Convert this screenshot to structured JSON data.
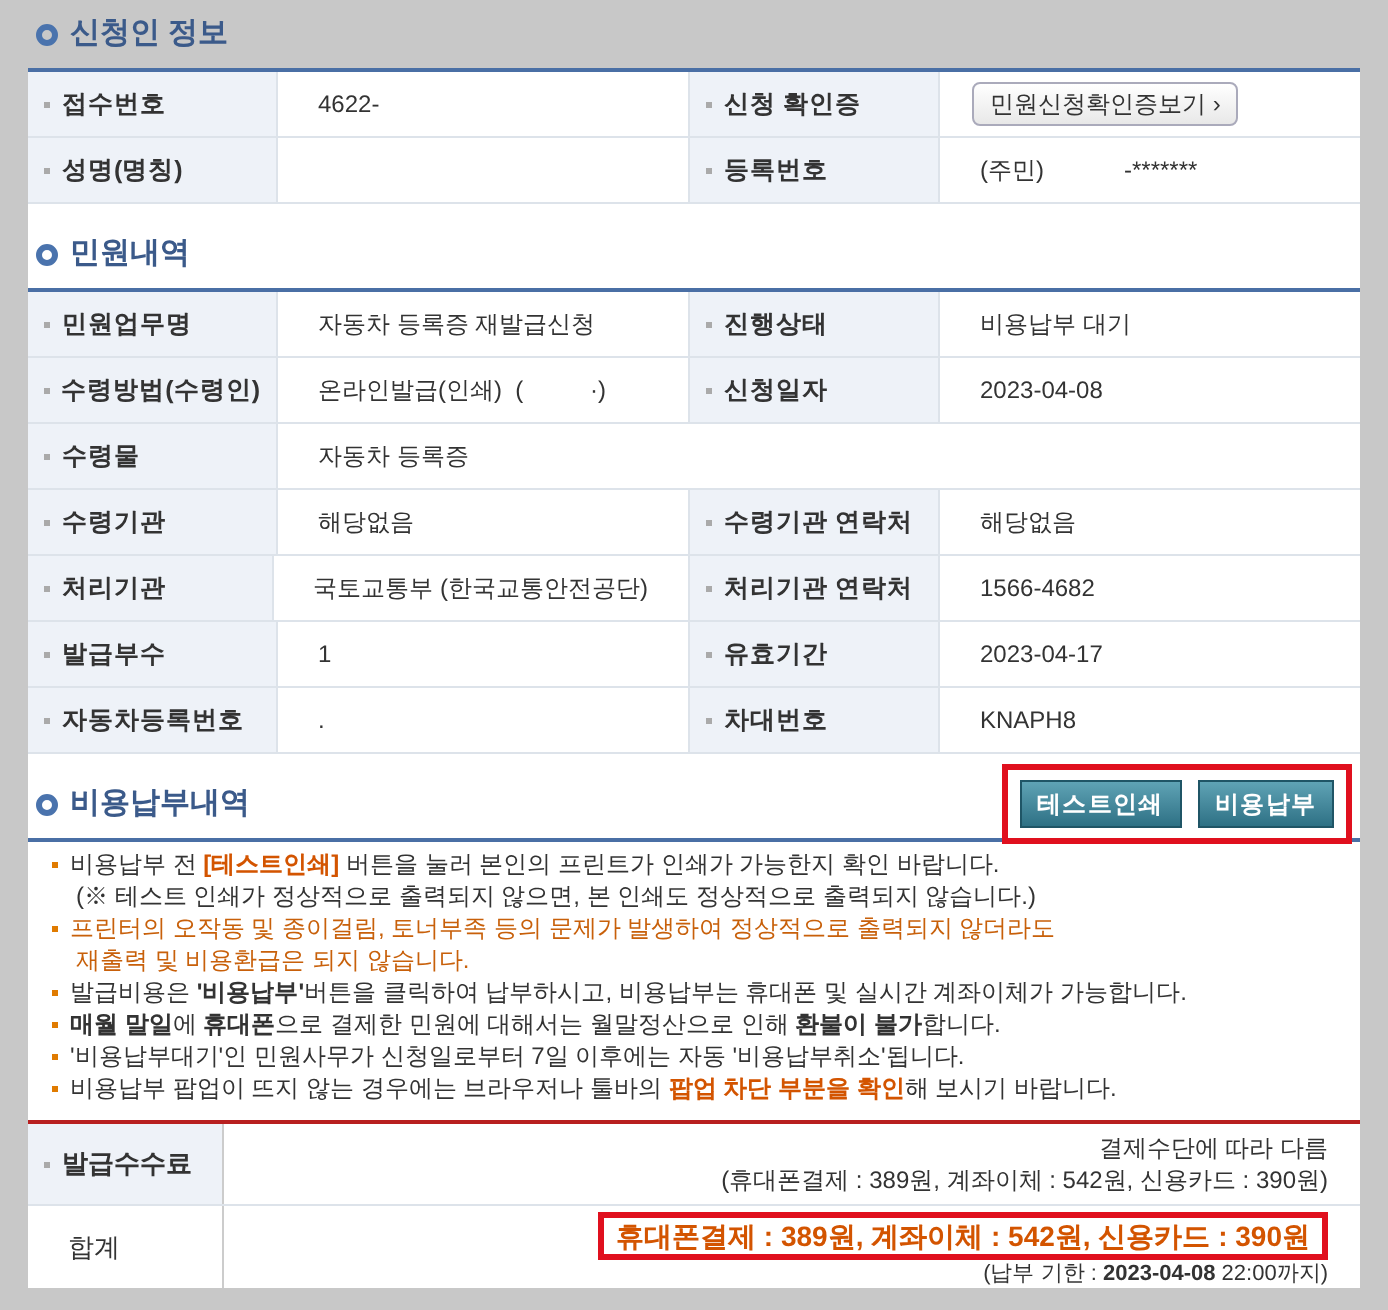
{
  "applicant": {
    "title": "신청인 정보",
    "rows": [
      [
        {
          "label": "접수번호",
          "value": "4622-"
        },
        {
          "label": "신청 확인증",
          "button": "민원신청확인증보기 ›"
        }
      ],
      [
        {
          "label": "성명(명칭)"
        },
        {
          "label": "등록번호",
          "value": "(주민)",
          "value2": "-*******"
        }
      ]
    ]
  },
  "petition": {
    "title": "민원내역",
    "rows": [
      [
        {
          "label": "민원업무명",
          "value": "자동차 등록증 재발급신청"
        },
        {
          "label": "진행상태",
          "value": "비용납부 대기"
        }
      ],
      [
        {
          "label": "수령방법(수령인)",
          "value": "온라인발급(인쇄)  (          ·)"
        },
        {
          "label": "신청일자",
          "value": "2023-04-08"
        }
      ],
      [
        {
          "label": "수령물",
          "value": "자동차 등록증"
        }
      ],
      [
        {
          "label": "수령기관",
          "value": "해당없음"
        },
        {
          "label": "수령기관 연락처",
          "value": "해당없음"
        }
      ],
      [
        {
          "label": "처리기관",
          "value": "국토교통부 (한국교통안전공단)"
        },
        {
          "label": "처리기관 연락처",
          "value": "1566-4682"
        }
      ],
      [
        {
          "label": "발급부수",
          "value": "1"
        },
        {
          "label": "유효기간",
          "value": "2023-04-17"
        }
      ],
      [
        {
          "label": "자동차등록번호",
          "value": "."
        },
        {
          "label": "차대번호",
          "value": "KNAPH8"
        }
      ]
    ]
  },
  "payment": {
    "title": "비용납부내역",
    "highlighted": true,
    "buttons": [
      "테스트인쇄",
      "비용납부"
    ],
    "notes": [
      {
        "kind": "plain",
        "parts": [
          {
            "t": "비용납부 전 ",
            "bold": false,
            "accent": false
          },
          {
            "t": "[테스트인쇄]",
            "bold": true,
            "accent": true
          },
          {
            "t": " 버튼을 눌러 본인의 프린트가 인쇄가 가능한지 확인 바랍니다.",
            "bold": false,
            "accent": false
          }
        ],
        "sub": "(※ 테스트 인쇄가 정상적으로 출력되지 않으면, 본 인쇄도 정상적으로 출력되지 않습니다.)"
      },
      {
        "kind": "warning",
        "parts": [
          {
            "t": "프린터의 오작동 및 종이걸림, 토너부족 등의 문제가 발생하여 정상적으로 출력되지 않더라도",
            "bold": false,
            "accent": false
          }
        ],
        "sub": "재출력 및 비용환급은 되지 않습니다."
      },
      {
        "kind": "plain",
        "parts": [
          {
            "t": "발급비용은 ",
            "bold": false,
            "accent": false
          },
          {
            "t": "'비용납부'",
            "bold": true,
            "accent": false
          },
          {
            "t": "버튼을 클릭하여 납부하시고, 비용납부는 휴대폰 및 실시간 계좌이체가 가능합니다.",
            "bold": false,
            "accent": false
          }
        ]
      },
      {
        "kind": "plain",
        "parts": [
          {
            "t": "매월 말일",
            "bold": true,
            "accent": false
          },
          {
            "t": "에 ",
            "bold": false,
            "accent": false
          },
          {
            "t": "휴대폰",
            "bold": true,
            "accent": false
          },
          {
            "t": "으로 결제한 민원에 대해서는 월말정산으로 인해 ",
            "bold": false,
            "accent": false
          },
          {
            "t": "환불이 불가",
            "bold": true,
            "accent": false
          },
          {
            "t": "합니다.",
            "bold": false,
            "accent": false
          }
        ]
      },
      {
        "kind": "plain",
        "parts": [
          {
            "t": "'비용납부대기'인 민원사무가 신청일로부터 7일 이후에는 자동 '비용납부취소'됩니다.",
            "bold": false,
            "accent": false
          }
        ]
      },
      {
        "kind": "plain",
        "parts": [
          {
            "t": "비용납부 팝업이 뜨지 않는 경우에는 브라우저나 툴바의 ",
            "bold": false,
            "accent": false
          },
          {
            "t": "팝업 차단 부분을 확인",
            "bold": true,
            "accent": true
          },
          {
            "t": "해 보시기 바랍니다.",
            "bold": false,
            "accent": false
          }
        ]
      }
    ],
    "fee": {
      "label": "발급수수료",
      "line1": "결제수단에 따라 다름",
      "line2": "(휴대폰결제 : 389원, 계좌이체 : 542원, 신용카드 : 390원)"
    },
    "total": {
      "label": "합계",
      "amount": "휴대폰결제 : 389원, 계좌이체 : 542원, 신용카드 : 390원",
      "highlighted": true,
      "deadline_prefix": "(납부 기한 : ",
      "deadline_date": "2023-04-08",
      "deadline_suffix": " 22:00까지)"
    }
  }
}
